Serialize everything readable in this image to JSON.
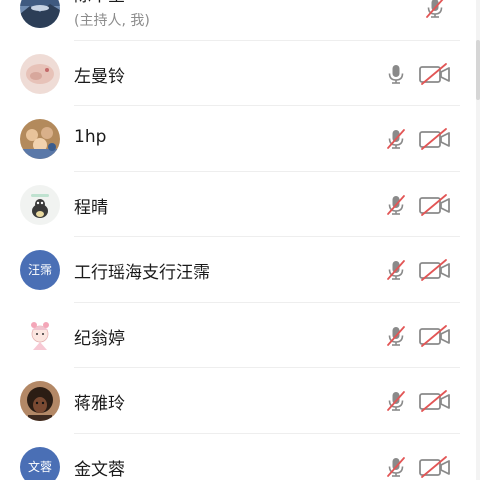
{
  "participants": [
    {
      "name": "陈中堂",
      "subtitle": "(主持人, 我)",
      "avatar": {
        "type": "photo",
        "icon": "landscape-photo-avatar"
      },
      "mic": "muted",
      "camera": "hidden"
    },
    {
      "name": "左曼铃",
      "avatar": {
        "type": "photo",
        "icon": "hand-photo-avatar"
      },
      "mic": "active",
      "camera": "off"
    },
    {
      "name": "1hp",
      "avatar": {
        "type": "photo",
        "icon": "group-photo-avatar"
      },
      "mic": "muted",
      "camera": "off"
    },
    {
      "name": "程晴",
      "avatar": {
        "type": "photo",
        "icon": "cartoon-bird-avatar"
      },
      "mic": "muted",
      "camera": "off"
    },
    {
      "name": "工行瑶海支行汪霈",
      "avatar": {
        "type": "text",
        "text": "汪霈"
      },
      "mic": "muted",
      "camera": "off"
    },
    {
      "name": "纪翁婷",
      "avatar": {
        "type": "photo",
        "icon": "cartoon-girl-avatar"
      },
      "mic": "muted",
      "camera": "off"
    },
    {
      "name": "蒋雅玲",
      "avatar": {
        "type": "photo",
        "icon": "dark-portrait-avatar"
      },
      "mic": "muted",
      "camera": "off"
    },
    {
      "name": "金文蓉",
      "avatar": {
        "type": "text",
        "text": "文蓉"
      },
      "mic": "muted",
      "camera": "off"
    }
  ],
  "colors": {
    "text_avatar_bg": "#4a6fb5",
    "icon_gray": "#8a8a8a",
    "mute_slash": "#e25656",
    "name_text": "#1a1a1a",
    "subtitle_text": "#8c8c8c"
  }
}
